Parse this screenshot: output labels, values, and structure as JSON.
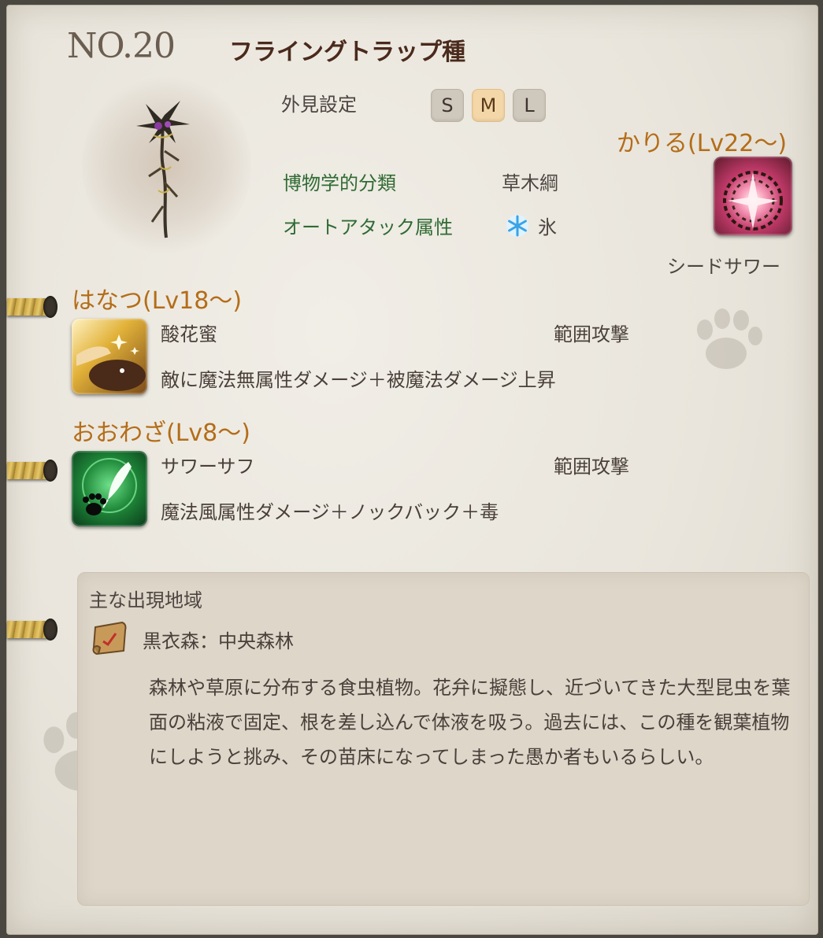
{
  "entry": {
    "number": "NO.20",
    "name": "フライングトラップ種"
  },
  "appearance": {
    "label": "外見設定",
    "sizes": [
      "S",
      "M",
      "L"
    ],
    "selected": "M"
  },
  "classification": {
    "label": "博物学的分類",
    "value": "草木綱"
  },
  "auto_attack": {
    "label": "オートアタック属性",
    "icon": "ice-icon",
    "value": "氷"
  },
  "kariru": {
    "header": "かりる(Lv22～)",
    "skill_name": "シードサワー",
    "icon": "seed-sour-icon"
  },
  "hanatsu": {
    "header": "はなつ(Lv18～)",
    "skill_name": "酸花蜜",
    "type": "範囲攻撃",
    "effect": "敵に魔法無属性ダメージ＋被魔法ダメージ上昇",
    "icon": "acid-nectar-icon"
  },
  "oowaza": {
    "header": "おおわざ(Lv8～)",
    "skill_name": "サワーサフ",
    "type": "範囲攻撃",
    "effect": "魔法風属性ダメージ＋ノックバック＋毒",
    "icon": "sour-sough-icon"
  },
  "region": {
    "title": "主な出現地域",
    "location": "黒衣森：中央森林",
    "map_icon": "map-scroll-icon",
    "description": "森林や草原に分布する食虫植物。花弁に擬態し、近づいてきた大型昆虫を葉面の粘液で固定、根を差し込んで体液を吸う。過去には、この種を観葉植物にしようと挑み、その苗床になってしまった愚か者もいるらしい。"
  },
  "colors": {
    "section_header": "#b46d18",
    "label_green": "#2f6b33",
    "title": "#4a2a1c",
    "selected_size": "#f4d7a8"
  }
}
